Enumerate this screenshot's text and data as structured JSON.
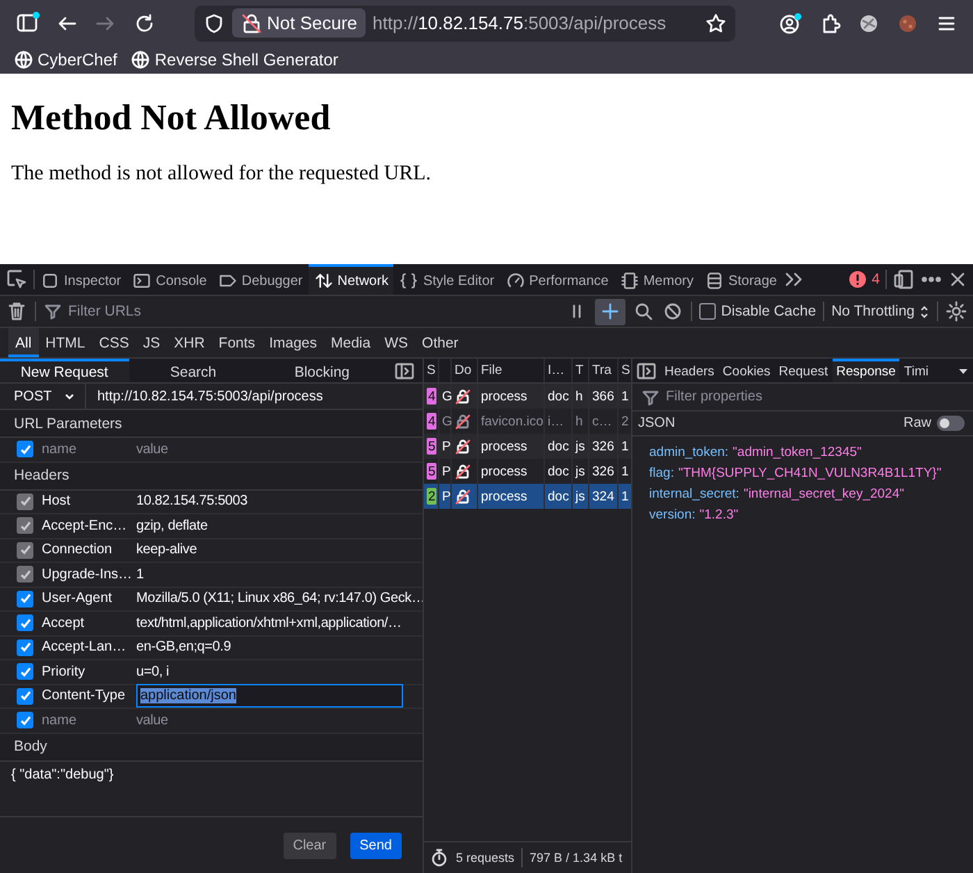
{
  "browser_toolbar": {
    "forward_disabled": true,
    "security_label": "Not Secure",
    "url": {
      "scheme": "http://",
      "host": "10.82.154.75",
      "path": ":5003/api/process"
    }
  },
  "bookmarks": [
    {
      "label": "CyberChef"
    },
    {
      "label": "Reverse Shell Generator"
    }
  ],
  "page": {
    "heading": "Method Not Allowed",
    "message": "The method is not allowed for the requested URL."
  },
  "devtools": {
    "tabs": [
      {
        "label": "Inspector",
        "selected": false
      },
      {
        "label": "Console",
        "selected": false
      },
      {
        "label": "Debugger",
        "selected": false
      },
      {
        "label": "Network",
        "selected": true
      },
      {
        "label": "Style Editor",
        "selected": false
      },
      {
        "label": "Performance",
        "selected": false
      },
      {
        "label": "Memory",
        "selected": false
      },
      {
        "label": "Storage",
        "selected": false
      }
    ],
    "error_count": "4"
  },
  "network_toolbar": {
    "filter_placeholder": "Filter URLs",
    "new_request_selected": true,
    "disable_cache": {
      "label": "Disable Cache",
      "checked": false
    },
    "throttling": "No Throttling"
  },
  "type_filters": [
    {
      "label": "All",
      "selected": true
    },
    {
      "label": "HTML",
      "selected": false
    },
    {
      "label": "CSS",
      "selected": false
    },
    {
      "label": "JS",
      "selected": false
    },
    {
      "label": "XHR",
      "selected": false
    },
    {
      "label": "Fonts",
      "selected": false
    },
    {
      "label": "Images",
      "selected": false
    },
    {
      "label": "Media",
      "selected": false
    },
    {
      "label": "WS",
      "selected": false
    },
    {
      "label": "Other",
      "selected": false
    }
  ],
  "new_request": {
    "tabs": [
      {
        "label": "New Request",
        "selected": true
      },
      {
        "label": "Search",
        "selected": false
      },
      {
        "label": "Blocking",
        "selected": false
      }
    ],
    "method": "POST",
    "url": "http://10.82.154.75:5003/api/process",
    "url_parameters": {
      "title": "URL Parameters",
      "rows": [
        {
          "checked": true,
          "name_placeholder": "name",
          "value_placeholder": "value"
        }
      ]
    },
    "headers": {
      "title": "Headers",
      "rows": [
        {
          "name": "Host",
          "value": "10.82.154.75:5003",
          "checked": true,
          "disabled": true,
          "focused": false
        },
        {
          "name": "Accept-Enc…",
          "value": "gzip, deflate",
          "checked": true,
          "disabled": true,
          "focused": false
        },
        {
          "name": "Connection",
          "value": "keep-alive",
          "checked": true,
          "disabled": true,
          "focused": false
        },
        {
          "name": "Upgrade-Ins…",
          "value": "1",
          "checked": true,
          "disabled": true,
          "focused": false
        },
        {
          "name": "User-Agent",
          "value": "Mozilla/5.0 (X11; Linux x86_64; rv:147.0) Geck…",
          "checked": true,
          "disabled": false,
          "focused": false
        },
        {
          "name": "Accept",
          "value": "text/html,application/xhtml+xml,application/…",
          "checked": true,
          "disabled": false,
          "focused": false
        },
        {
          "name": "Accept-Lan…",
          "value": "en-GB,en;q=0.9",
          "checked": true,
          "disabled": false,
          "focused": false
        },
        {
          "name": "Priority",
          "value": "u=0, i",
          "checked": true,
          "disabled": false,
          "focused": false
        },
        {
          "name": "Content-Type",
          "value": "application/json",
          "checked": true,
          "disabled": false,
          "focused": true
        }
      ],
      "new_row": {
        "checked": true,
        "name_placeholder": "name",
        "value_placeholder": "value"
      }
    },
    "body": {
      "title": "Body",
      "value": "{ \"data\":\"debug\"}"
    },
    "buttons": [
      {
        "label": "Clear",
        "primary": false
      },
      {
        "label": "Send",
        "primary": true
      }
    ]
  },
  "request_list": {
    "columns": [
      "S",
      "Do",
      "File",
      "I…",
      "T",
      "Tra",
      "S"
    ],
    "rows": [
      {
        "status": "4",
        "color": "#e06ee0",
        "method": "G",
        "file": "process",
        "initiator": "doc",
        "type": "h",
        "transferred": "366",
        "size": "1",
        "dimmed": false,
        "selected": false
      },
      {
        "status": "4",
        "color": "#e06ee0",
        "method": "G",
        "file": "favicon.ico",
        "initiator": "i…",
        "type": "h",
        "transferred": "c…",
        "size": "2",
        "dimmed": true,
        "selected": false
      },
      {
        "status": "5",
        "color": "#e06ee0",
        "method": "P",
        "file": "process",
        "initiator": "doc",
        "type": "js",
        "transferred": "326",
        "size": "1",
        "dimmed": false,
        "selected": false
      },
      {
        "status": "5",
        "color": "#e06ee0",
        "method": "P",
        "file": "process",
        "initiator": "doc",
        "type": "js",
        "transferred": "326",
        "size": "1",
        "dimmed": false,
        "selected": false
      },
      {
        "status": "2",
        "color": "#70bf53",
        "method": "P",
        "file": "process",
        "initiator": "doc",
        "type": "js",
        "transferred": "324",
        "size": "1",
        "dimmed": false,
        "selected": true
      }
    ],
    "status_bar": {
      "requests": "5 requests",
      "transferred": "797 B / 1.34 kB t"
    }
  },
  "response": {
    "tabs": [
      {
        "label": "Headers",
        "selected": false
      },
      {
        "label": "Cookies",
        "selected": false
      },
      {
        "label": "Request",
        "selected": false
      },
      {
        "label": "Response",
        "selected": true
      },
      {
        "label": "Timi",
        "selected": false
      }
    ],
    "filter_placeholder": "Filter properties",
    "view_label": "JSON",
    "raw": {
      "label": "Raw",
      "on": false
    },
    "properties": [
      {
        "key": "admin_token:",
        "value": "\"admin_token_12345\""
      },
      {
        "key": "flag:",
        "value": "\"THM{SUPPLY_CH41N_VULN3R4B1L1TY}\""
      },
      {
        "key": "internal_secret:",
        "value": "\"internal_secret_key_2024\""
      },
      {
        "key": "version:",
        "value": "\"1.2.3\""
      }
    ]
  }
}
